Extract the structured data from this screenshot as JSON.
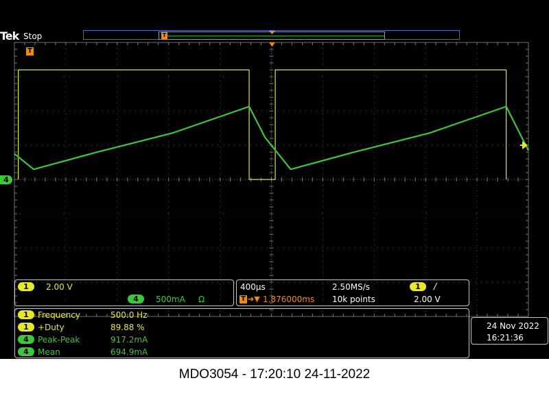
{
  "header": {
    "brand": "Tek",
    "run_state": "Stop"
  },
  "chart_data": {
    "type": "line",
    "xlabel": "",
    "ylabel": "",
    "grid": true,
    "x_range_ms": [
      -0.03,
      3.97
    ],
    "period_ms": 2.0,
    "series": [
      {
        "channel": "1",
        "color": "#e8e82a",
        "x_ms": [
          0.0,
          0.0,
          1.797,
          1.797,
          2.0,
          2.0,
          3.797,
          3.797
        ],
        "y_V": [
          0.0,
          6.4,
          6.4,
          0.0,
          0.0,
          6.4,
          6.4,
          0.0
        ]
      },
      {
        "channel": "4",
        "color": "#3cc83c",
        "x_ms": [
          -0.03,
          0.12,
          0.6,
          1.2,
          1.797,
          1.92,
          2.12,
          2.6,
          3.2,
          3.797,
          3.97
        ],
        "y_mA": [
          375,
          148,
          393,
          678,
          1065,
          616,
          148,
          393,
          678,
          1065,
          424
        ]
      }
    ]
  },
  "ch1": {
    "label": "1",
    "scale": "2.00 V"
  },
  "ch4": {
    "label": "4",
    "scale": "500mA",
    "impedance": "Ω"
  },
  "timebase": {
    "per_div": "400µs",
    "sample_rate": "2.50MS/s",
    "trigger_delay": "1.876000ms",
    "record_length": "10k points"
  },
  "trigger": {
    "source": "1",
    "slope": "/",
    "level": "2.00 V",
    "marker": "T"
  },
  "measurements": [
    {
      "ch": "1",
      "name": "Frequency",
      "value": "500.0 Hz",
      "color": "yellow"
    },
    {
      "ch": "1",
      "name": "+Duty",
      "value": "89.88 %",
      "color": "yellow"
    },
    {
      "ch": "4",
      "name": "Peak-Peak",
      "value": "917.2mA",
      "color": "green"
    },
    {
      "ch": "4",
      "name": "Mean",
      "value": "694.9mA",
      "color": "green"
    }
  ],
  "clock": {
    "date": "24 Nov 2022",
    "time": "16:21:36"
  },
  "caption": "MDO3054 - 17:20:10   24-11-2022"
}
